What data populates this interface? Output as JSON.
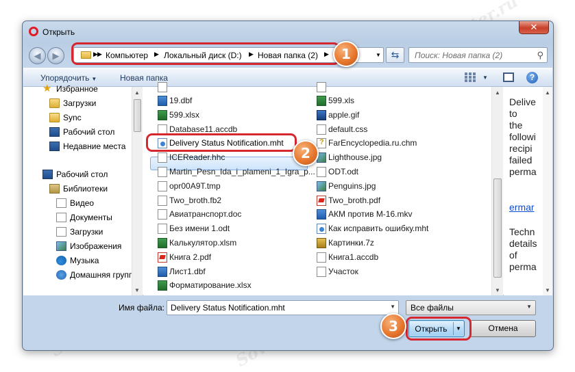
{
  "window": {
    "title": "Открыть",
    "close_glyph": "✕"
  },
  "address": {
    "crumbs": [
      "Компьютер",
      "Локальный диск (D:)",
      "Новая папка (2)"
    ],
    "search_placeholder": "Поиск: Новая папка (2)"
  },
  "toolbar": {
    "organize": "Упорядочить",
    "new_folder": "Новая папка"
  },
  "nav": {
    "items": [
      {
        "label": "Избранное",
        "icon": "star-icon"
      },
      {
        "label": "Загрузки",
        "icon": "downloads-folder-icon"
      },
      {
        "label": "Sync",
        "icon": "sync-folder-icon"
      },
      {
        "label": "Рабочий стол",
        "icon": "desktop-icon"
      },
      {
        "label": "Недавние места",
        "icon": "recent-places-icon"
      },
      {
        "label": "Рабочий стол",
        "icon": "desktop-icon"
      },
      {
        "label": "Библиотеки",
        "icon": "libraries-icon"
      },
      {
        "label": "Видео",
        "icon": "video-library-icon"
      },
      {
        "label": "Документы",
        "icon": "documents-library-icon"
      },
      {
        "label": "Загрузки",
        "icon": "downloads-library-icon"
      },
      {
        "label": "Изображения",
        "icon": "pictures-library-icon"
      },
      {
        "label": "Музыка",
        "icon": "music-library-icon"
      },
      {
        "label": "Домашняя группа",
        "icon": "homegroup-icon"
      }
    ]
  },
  "files": {
    "col1": [
      {
        "name": "19.dbf",
        "icon": "dbf-icon"
      },
      {
        "name": "599.xlsx",
        "icon": "excel-icon"
      },
      {
        "name": "Database11.accdb",
        "icon": "accdb-icon"
      },
      {
        "name": "Delivery Status Notification.mht",
        "icon": "mht-icon",
        "selected": true
      },
      {
        "name": "ICEReader.hhc",
        "icon": "hhc-icon"
      },
      {
        "name": "Martin_Pesn_Ida_i_plameni_1_Igra_p...",
        "icon": "odt-icon"
      },
      {
        "name": "opr00A9T.tmp",
        "icon": "tmp-icon"
      },
      {
        "name": "Two_broth.fb2",
        "icon": "fb2-icon"
      },
      {
        "name": "Авиатранспорт.doc",
        "icon": "doc-icon"
      },
      {
        "name": "Без имени 1.odt",
        "icon": "odt-icon"
      },
      {
        "name": "Калькулятор.xlsm",
        "icon": "excel-icon"
      },
      {
        "name": "Книга 2.pdf",
        "icon": "pdf-icon"
      },
      {
        "name": "Лист1.dbf",
        "icon": "dbf-icon"
      },
      {
        "name": "Форматирование.xlsx",
        "icon": "excel-icon"
      }
    ],
    "col2": [
      {
        "name": "599.xls",
        "icon": "excel-icon"
      },
      {
        "name": "apple.gif",
        "icon": "gif-icon"
      },
      {
        "name": "default.css",
        "icon": "css-icon"
      },
      {
        "name": "FarEncyclopedia.ru.chm",
        "icon": "chm-help-icon"
      },
      {
        "name": "Lighthouse.jpg",
        "icon": "jpg-icon"
      },
      {
        "name": "ODT.odt",
        "icon": "odt-icon"
      },
      {
        "name": "Penguins.jpg",
        "icon": "jpg-icon"
      },
      {
        "name": "Two_broth.pdf",
        "icon": "pdf-icon"
      },
      {
        "name": "АКМ против М-16.mkv",
        "icon": "mkv-icon"
      },
      {
        "name": "Как исправить ошибку.mht",
        "icon": "mht-icon"
      },
      {
        "name": "Картинки.7z",
        "icon": "7z-icon"
      },
      {
        "name": "Книга1.accdb",
        "icon": "accdb-icon"
      },
      {
        "name": "Участок",
        "icon": "generic-file-icon"
      }
    ]
  },
  "preview": {
    "lines": [
      "Delive",
      "to",
      "the",
      "followi",
      "recipi",
      "failed",
      "perma",
      "ermar",
      "Techn",
      "details",
      "of",
      "perma"
    ]
  },
  "bottom": {
    "filename_label": "Имя файла:",
    "filename_value": "Delivery Status Notification.mht",
    "filetype_value": "Все файлы",
    "open_label": "Открыть",
    "cancel_label": "Отмена"
  },
  "callouts": [
    "1",
    "2",
    "3"
  ],
  "watermark": "Sovetcomputer.ru",
  "colors": {
    "callout_ring": "#d6272f",
    "callout_badge": "#e8782e",
    "selection": "#cde4fb",
    "link": "#0b4bd1"
  }
}
